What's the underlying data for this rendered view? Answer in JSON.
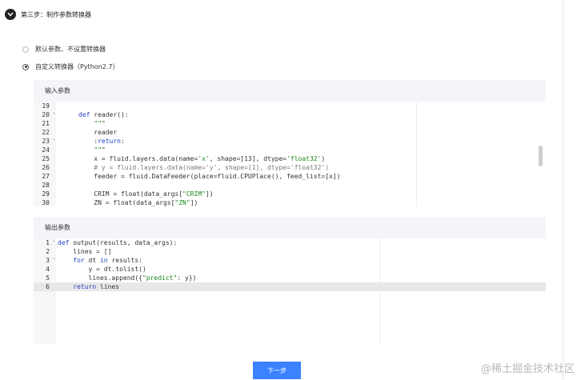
{
  "step": {
    "title": "第三步：制作参数转换器"
  },
  "options": [
    {
      "label": "默认参数、不设置转换器",
      "selected": false
    },
    {
      "label": "自定义转换器（Python2.7）",
      "selected": true
    }
  ],
  "input_panel": {
    "title": "输入参数",
    "lines": [
      {
        "no": "19",
        "fold": false,
        "text": ""
      },
      {
        "no": "20",
        "fold": true,
        "text": "def reader():"
      },
      {
        "no": "21",
        "fold": false,
        "text": "    \"\"\""
      },
      {
        "no": "22",
        "fold": false,
        "text": "    reader"
      },
      {
        "no": "23",
        "fold": true,
        "text": "    :return:"
      },
      {
        "no": "24",
        "fold": false,
        "text": "    \"\"\""
      },
      {
        "no": "25",
        "fold": false,
        "text": "    x = fluid.layers.data(name='x', shape=[13], dtype='float32')"
      },
      {
        "no": "26",
        "fold": false,
        "text": "    # y = fluid.layers.data(name='y', shape=[1], dtype='float32')"
      },
      {
        "no": "27",
        "fold": false,
        "text": "    feeder = fluid.DataFeeder(place=fluid.CPUPlace(), feed_list=[x])"
      },
      {
        "no": "28",
        "fold": false,
        "text": ""
      },
      {
        "no": "29",
        "fold": false,
        "text": "    CRIM = float(data_args[\"CRIM\"])"
      },
      {
        "no": "30",
        "fold": false,
        "text": "    ZN = float(data_args[\"ZN\"])"
      }
    ]
  },
  "output_panel": {
    "title": "输出参数",
    "lines": [
      {
        "no": "1",
        "fold": true,
        "text": "def output(results, data_args):"
      },
      {
        "no": "2",
        "fold": false,
        "text": "    lines = []"
      },
      {
        "no": "3",
        "fold": true,
        "text": "    for dt in results:"
      },
      {
        "no": "4",
        "fold": false,
        "text": "        y = dt.tolist()"
      },
      {
        "no": "5",
        "fold": false,
        "text": "        lines.append({\"predict\": y})"
      },
      {
        "no": "6",
        "fold": false,
        "text": "    return lines"
      }
    ]
  },
  "actions": {
    "next_label": "下一步"
  },
  "watermark": "@稀土掘金技术社区"
}
